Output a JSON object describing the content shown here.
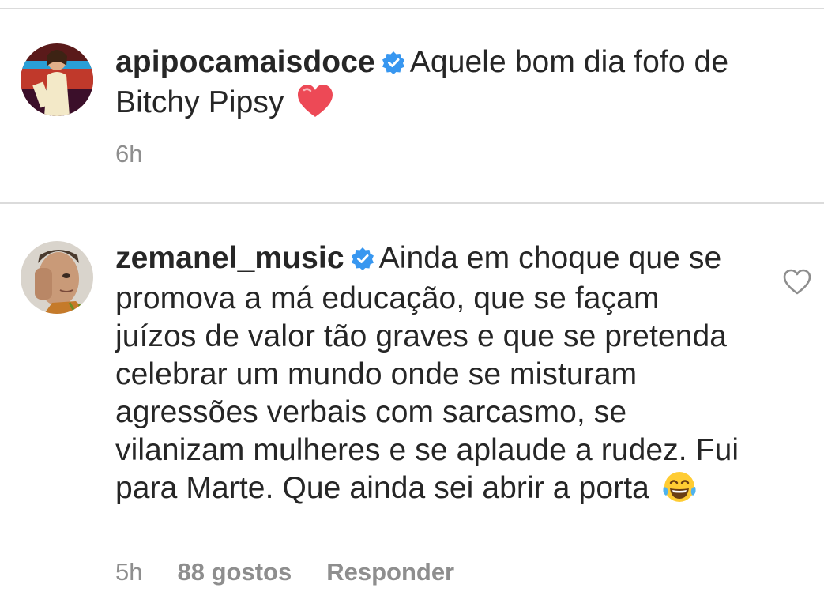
{
  "comments": [
    {
      "username": "apipocamaisdoce",
      "verified": true,
      "avatar_icon": "avatar-photo-woman",
      "text": "Aquele bom dia fofo de Bitchy Pipsy",
      "emoji": "red-heart",
      "time": "6h"
    },
    {
      "username": "zemanel_music",
      "verified": true,
      "avatar_icon": "avatar-photo-man",
      "text": "Ainda em choque que se promova a má educação, que se façam juízos de valor tão graves e que se pretenda celebrar um mundo onde se misturam agressões verbais com sarcasmo, se vilanizam mulheres e se aplaude a rudez. Fui para Marte. Que ainda sei abrir a porta",
      "emoji": "tears-of-joy",
      "time": "5h",
      "likes": "88 gostos",
      "reply_label": "Responder",
      "like_icon": "heart-outline-icon"
    }
  ],
  "colors": {
    "text": "#262626",
    "meta": "#8e8e8e",
    "verified": "#3897f0",
    "divider": "#dbdbdb",
    "heart": "#ed4956"
  }
}
